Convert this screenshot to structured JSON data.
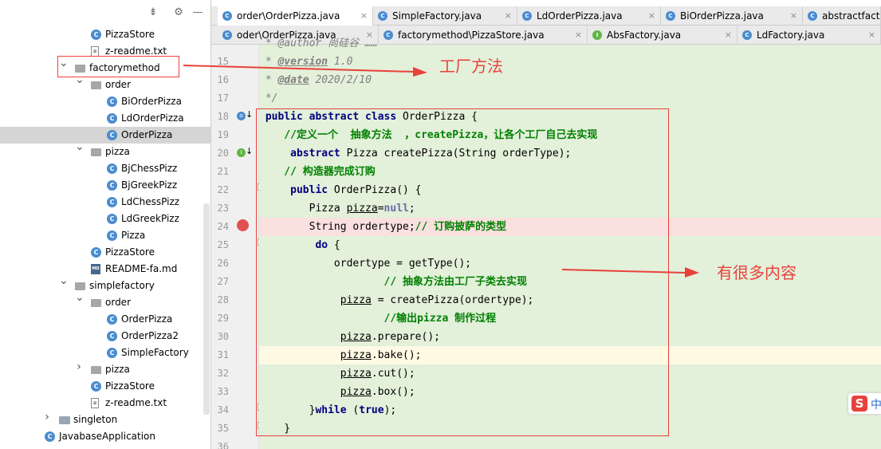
{
  "project_tree": [
    {
      "label": "PizzaStore",
      "icon": "class-icon",
      "level": 5,
      "chevron": ""
    },
    {
      "label": "z-readme.txt",
      "icon": "text-file-icon",
      "level": 5,
      "chevron": ""
    },
    {
      "label": "factorymethod",
      "icon": "package-icon",
      "level": 4,
      "chevron": "open"
    },
    {
      "label": "order",
      "icon": "package-icon",
      "level": 5,
      "chevron": "open"
    },
    {
      "label": "BiOrderPizza",
      "icon": "class-icon",
      "level": 6,
      "chevron": ""
    },
    {
      "label": "LdOrderPizza",
      "icon": "class-icon",
      "level": 6,
      "chevron": ""
    },
    {
      "label": "OrderPizza",
      "icon": "class-icon",
      "level": 6,
      "chevron": "",
      "selected": true
    },
    {
      "label": "pizza",
      "icon": "package-icon",
      "level": 5,
      "chevron": "open"
    },
    {
      "label": "BjChessPizz",
      "icon": "class-icon",
      "level": 6,
      "chevron": ""
    },
    {
      "label": "BjGreekPizz",
      "icon": "class-icon",
      "level": 6,
      "chevron": ""
    },
    {
      "label": "LdChessPizz",
      "icon": "class-icon",
      "level": 6,
      "chevron": ""
    },
    {
      "label": "LdGreekPizz",
      "icon": "class-icon",
      "level": 6,
      "chevron": ""
    },
    {
      "label": "Pizza",
      "icon": "class-icon",
      "level": 6,
      "chevron": ""
    },
    {
      "label": "PizzaStore",
      "icon": "class-icon",
      "level": 5,
      "chevron": ""
    },
    {
      "label": "README-fa.md",
      "icon": "markdown-file-icon",
      "level": 5,
      "chevron": ""
    },
    {
      "label": "simplefactory",
      "icon": "package-icon",
      "level": 4,
      "chevron": "open"
    },
    {
      "label": "order",
      "icon": "package-icon",
      "level": 5,
      "chevron": "open"
    },
    {
      "label": "OrderPizza",
      "icon": "class-icon",
      "level": 6,
      "chevron": ""
    },
    {
      "label": "OrderPizza2",
      "icon": "class-icon",
      "level": 6,
      "chevron": ""
    },
    {
      "label": "SimpleFactory",
      "icon": "class-icon",
      "level": 6,
      "chevron": ""
    },
    {
      "label": "pizza",
      "icon": "package-icon",
      "level": 5,
      "chevron": "closed"
    },
    {
      "label": "PizzaStore",
      "icon": "class-icon",
      "level": 5,
      "chevron": ""
    },
    {
      "label": "z-readme.txt",
      "icon": "text-file-icon",
      "level": 5,
      "chevron": ""
    },
    {
      "label": "singleton",
      "icon": "folder-icon",
      "level": 3,
      "chevron": "closed"
    },
    {
      "label": "JavabaseApplication",
      "icon": "app-class-icon",
      "level": 2,
      "chevron": ""
    }
  ],
  "tabs_row1": [
    {
      "label": "order\\OrderPizza.java",
      "active": true,
      "icon": "class-icon"
    },
    {
      "label": "SimpleFactory.java",
      "active": false,
      "icon": "class-icon"
    },
    {
      "label": "LdOrderPizza.java",
      "active": false,
      "icon": "class-icon"
    },
    {
      "label": "BiOrderPizza.java",
      "active": false,
      "icon": "class-icon"
    },
    {
      "label": "abstractfact",
      "active": false,
      "icon": "class-icon"
    }
  ],
  "tabs_row2": [
    {
      "label": "oder\\OrderPizza.java",
      "icon": "class-icon"
    },
    {
      "label": "factorymethod\\PizzaStore.java",
      "icon": "class-icon"
    },
    {
      "label": "AbsFactory.java",
      "icon": "interface-icon"
    },
    {
      "label": "LdFactory.java",
      "icon": "class-icon"
    }
  ],
  "annotations": {
    "note_factory_method": "工厂方法",
    "note_much_content": "有很多内容"
  },
  "line_numbers": [
    "15",
    "16",
    "17",
    "18",
    "19",
    "20",
    "21",
    "22",
    "23",
    "24",
    "25",
    "26",
    "27",
    "28",
    "29",
    "30",
    "31",
    "32",
    "33",
    "34",
    "35",
    "36"
  ],
  "code": {
    "l14_partial": " * @author 尚硅谷 ……",
    "l15_tag": "@version",
    "l15_text": " 1.0",
    "l16_tag": "@date",
    "l16_text": " 2020/2/10",
    "l17": " */",
    "l18_kw": "public abstract class",
    "l18_rest": " OrderPizza {",
    "l19": "    //定义一个  抽象方法  ，createPizza，让各个工厂自己去实现",
    "l20_kw": "abstract",
    "l20_rest": " Pizza createPizza(String orderType);",
    "l21": "    // 构造器完成订购",
    "l22_kw": "public",
    "l22_rest": " OrderPizza() {",
    "l23_a": "        Pizza ",
    "l23_b": "pizza",
    "l23_c": "=",
    "l23_d": "null",
    "l23_e": ";",
    "l24_a": "        String ordertype;",
    "l24_b": "// 订购披萨的类型",
    "l25_kw": "do",
    "l25_rest": " {",
    "l26": "            ordertype = getType();",
    "l27": "            // 抽象方法由工厂子类去实现",
    "l28_a": "pizza",
    "l28_b": " = createPizza(ordertype);",
    "l29": "            //输出pizza 制作过程",
    "l30_a": "pizza",
    "l30_b": ".prepare();",
    "l31_a": "pizza",
    "l31_b": ".bake();",
    "l32_a": "pizza",
    "l32_b": ".cut();",
    "l33_a": "pizza",
    "l33_b": ".box();",
    "l34_a": "        }",
    "l34_kw1": "while",
    "l34_b": " (",
    "l34_kw2": "true",
    "l34_c": ");",
    "l35": "    }"
  },
  "ime": {
    "logo": "S",
    "lang": "中"
  },
  "colors": {
    "accent_red": "#e8423b",
    "code_bg": "#e3f0da",
    "breakpoint": "#e05252"
  }
}
